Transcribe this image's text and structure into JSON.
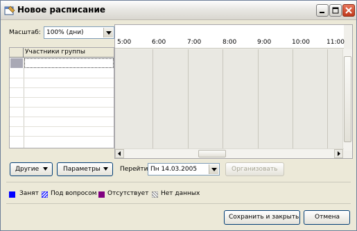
{
  "window": {
    "title": "Новое расписание"
  },
  "toolbar": {
    "scale_label": "Масштаб:",
    "scale_value": "100% (дни)"
  },
  "attendees": {
    "column_header": "Участники группы"
  },
  "timeline": {
    "times": [
      "5:00",
      "6:00",
      "7:00",
      "8:00",
      "9:00",
      "10:00",
      "11:00"
    ]
  },
  "actions": {
    "others_label": "Другие",
    "params_label": "Параметры",
    "goto_label": "Перейти",
    "date_value": "Пн 14.03.2005",
    "organize_label": "Организовать"
  },
  "legend": [
    {
      "label": "Занят",
      "color": "#0000ff"
    },
    {
      "label": "Под вопросом",
      "color": "#0000ff"
    },
    {
      "label": "Отсутствует",
      "color": "#800080"
    },
    {
      "label": "Нет данных",
      "color": "#808080"
    }
  ],
  "footer": {
    "save_close_label": "Сохранить и закрыть",
    "cancel_label": "Отмена"
  }
}
